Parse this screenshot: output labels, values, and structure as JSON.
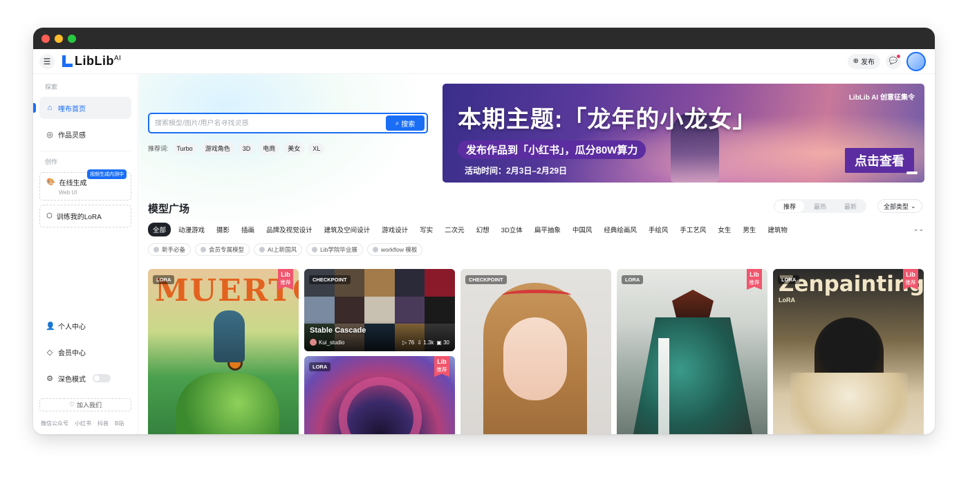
{
  "app": {
    "logo_text": "LibLib",
    "logo_sup": "AI"
  },
  "header": {
    "publish_label": "发布"
  },
  "sidebar": {
    "explore_title": "探索",
    "items": [
      {
        "label": "哩布首页",
        "icon": "home-icon"
      },
      {
        "label": "作品灵感",
        "icon": "lightbulb-icon"
      }
    ],
    "create_title": "创作",
    "online_gen": {
      "label": "在线生成",
      "sub": "Web UI",
      "tag": "视频生成内测中"
    },
    "train_lora": {
      "label": "训练我的LoRA"
    },
    "personal": "个人中心",
    "member": "会员中心",
    "dark_mode": "深色模式",
    "join_us": "加入我们",
    "footer_links": [
      "微信公众号",
      "小红书",
      "抖音",
      "B站"
    ]
  },
  "search": {
    "placeholder": "搜索模型/图片/用户名寻找灵感",
    "button_label": "搜索",
    "hot_label": "推荐词:",
    "hot_words": [
      "Turbo",
      "游戏角色",
      "3D",
      "电商",
      "美女",
      "XL"
    ]
  },
  "banner": {
    "brand": "LibLib AI 创意征集令",
    "headline": "本期主题:「龙年的小龙女」",
    "subline": "发布作品到「小红书」，瓜分80W算力",
    "date": "活动时间：2月3日–2月29日",
    "cta": "点击查看"
  },
  "models": {
    "title": "模型广场",
    "sort_tabs": [
      "推荐",
      "最热",
      "最新"
    ],
    "active_sort": "推荐",
    "type_dropdown": "全部类型",
    "categories": [
      "全部",
      "动漫游戏",
      "摄影",
      "插画",
      "品牌及视觉设计",
      "建筑及空间设计",
      "游戏设计",
      "写实",
      "二次元",
      "幻想",
      "3D立体",
      "扁平抽象",
      "中国风",
      "经典绘画风",
      "手绘风",
      "手工艺风",
      "女生",
      "男生",
      "建筑物"
    ],
    "subtags": [
      "新手必备",
      "会员专属模型",
      "AI上新国风",
      "Lib学院毕业展",
      "workflow 模板"
    ]
  },
  "cards": [
    {
      "type": "LORA",
      "rec_top": "Lib",
      "rec_bottom": "推荐",
      "overlay": "MUERTO"
    },
    {
      "type": "CHECKPOINT",
      "title": "Stable Cascade",
      "author": "Kui_studio",
      "stats": [
        "▷ 76",
        "⇩ 1.3k",
        "▣ 30"
      ]
    },
    {
      "type": "LORA",
      "rec_top": "Lib",
      "rec_bottom": "推荐"
    },
    {
      "type": "CHECKPOINT"
    },
    {
      "type": "LORA",
      "rec_top": "Lib",
      "rec_bottom": "推荐"
    },
    {
      "type": "LORA",
      "rec_top": "Lib",
      "rec_bottom": "推荐",
      "overlay": "Zenpainting",
      "overlay_sub": "LoRA"
    }
  ],
  "colors": {
    "accent": "#1a6ef5",
    "rec_badge": "#f0566e",
    "banner_purple": "#5b2da0"
  }
}
